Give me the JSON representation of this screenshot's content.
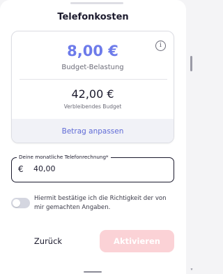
{
  "modal": {
    "title": "Telefonkosten",
    "info_icon": "i"
  },
  "budget": {
    "value": "8,00 €",
    "label": "Budget-Belastung",
    "remaining_value": "42,00 €",
    "remaining_label": "Verbleibendes Budget",
    "adjust_label": "Betrag anpassen"
  },
  "bill_input": {
    "label": "Deine monatliche Telefonrechnung*",
    "currency_symbol": "€",
    "value": "40,00"
  },
  "consent": {
    "text": "Hiermit bestätige ich die Richtigkeit der von mir gemachten Angaben.",
    "checked": false
  },
  "actions": {
    "back_label": "Zurück",
    "activate_label": "Aktivieren",
    "activate_enabled": false
  },
  "colors": {
    "accent": "#6d7bea",
    "link": "#5f6ad6",
    "disabled_button": "#fbd2d6",
    "text": "#1c1b2e"
  },
  "icons": {
    "info": "info-circle-icon",
    "scroll_down": "arrow-down-icon"
  }
}
